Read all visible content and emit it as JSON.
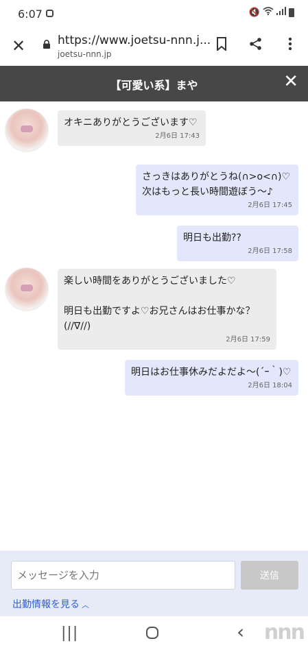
{
  "status_bar": {
    "time": "6:07"
  },
  "browser": {
    "url": "https://www.joetsu-nnn.j...",
    "domain": "joetsu-nnn.jp",
    "icons": [
      "close-icon",
      "lock-icon",
      "bookmark-icon",
      "share-icon",
      "more-vert-icon"
    ]
  },
  "header": {
    "title": "【可愛い系】まや",
    "close_symbol": "✕"
  },
  "messages": [
    {
      "side": "in",
      "text": "オキニありがとうございます♡",
      "time": "2月6日 17:43"
    },
    {
      "side": "out",
      "text": "さっきはありがとうね(∩>o<∩)♡\n次はもっと長い時間遊ぼう～♪",
      "time": "2月6日 17:45"
    },
    {
      "side": "out",
      "text": "明日も出勤??",
      "time": "2月6日 17:58"
    },
    {
      "side": "in",
      "text": "楽しい時間をありがとうございました♡\n\n明日も出勤ですよ♡お兄さんはお仕事かな？\n(//∇//)",
      "time": "2月6日 17:59"
    },
    {
      "side": "out",
      "text": "明日はお仕事休みだよだよ～(´ｰ｀)♡",
      "time": "2月6日 18:04"
    }
  ],
  "composer": {
    "placeholder": "メッセージを入力",
    "send_label": "送信",
    "attendance_link": "出勤情報を見る"
  },
  "nav": {
    "recent": "|||",
    "home": "○",
    "back": "‹",
    "watermark": "nnn"
  },
  "colors": {
    "header_bg": "#474747",
    "incoming_bubble": "#ececec",
    "outgoing_bubble": "#e3e7fb",
    "link": "#2f5fd1",
    "input_area_bg": "#e7ebf7"
  }
}
